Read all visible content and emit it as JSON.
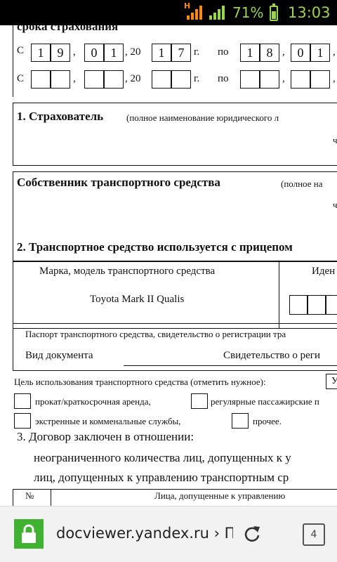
{
  "status": {
    "network": "H",
    "battery_pct": "71%",
    "time": "13:03"
  },
  "doc": {
    "period_heading": "срока страхования",
    "row1": {
      "c": "С",
      "d1": "1",
      "d2": "9",
      "m1": "0",
      "m2": "1",
      "comma": ",",
      "year_prefix": ", 20",
      "y1": "1",
      "y2": "7",
      "g": "г.",
      "po": "по",
      "td1": "1",
      "td2": "8",
      "tm1": "0",
      "tm2": "1"
    },
    "row2": {
      "c": "С",
      "comma": ",",
      "year_prefix": ", 20",
      "g": "г.",
      "po": "по"
    },
    "s1_title": "1. Страхователь",
    "s1_hint": "(полное наименование юридического л",
    "s1_cut": "ч",
    "owner_title": "Собственник транспортного средства",
    "owner_hint": "(полное на",
    "owner_cut": "ч",
    "s2_title": "2. Транспортное средство используется с прицепом",
    "col_make": "Марка, модель транспортного средства",
    "col_id": "Иден",
    "make_value": "Toyota Mark II Qualis",
    "passport_label": "Паспорт транспортного средства, свидетельство о регистрации тра",
    "doc_type_label": "Вид документа",
    "doc_type_value": "Свидетельство о реги",
    "purpose_label": "Цель использования транспортного средства (отметить нужное):",
    "purpose_cut": "У",
    "opt_rent": "прокат/краткосрочная аренда,",
    "opt_passenger": "регулярные пассажирские п",
    "opt_emergency": "экстренные и комменальные службы,",
    "opt_other": "прочее.",
    "s3_title": "3. Договор заключен в отношении:",
    "s3_line1": "неограниченного количества лиц, допущенных к у",
    "s3_line2": "лиц, допущенных к управлению транспортным ср",
    "tbl_no": "№",
    "tbl_persons": "Лица, допущенные к управлению"
  },
  "browser": {
    "url": "docviewer.yandex.ru › По",
    "tab_count": "4"
  },
  "colors": {
    "status_accent": "#9ad93b",
    "lock_green": "#3fb22f"
  },
  "icons": [
    "signal-icon",
    "battery-icon",
    "lock-icon",
    "reload-icon",
    "tabs-icon"
  ]
}
